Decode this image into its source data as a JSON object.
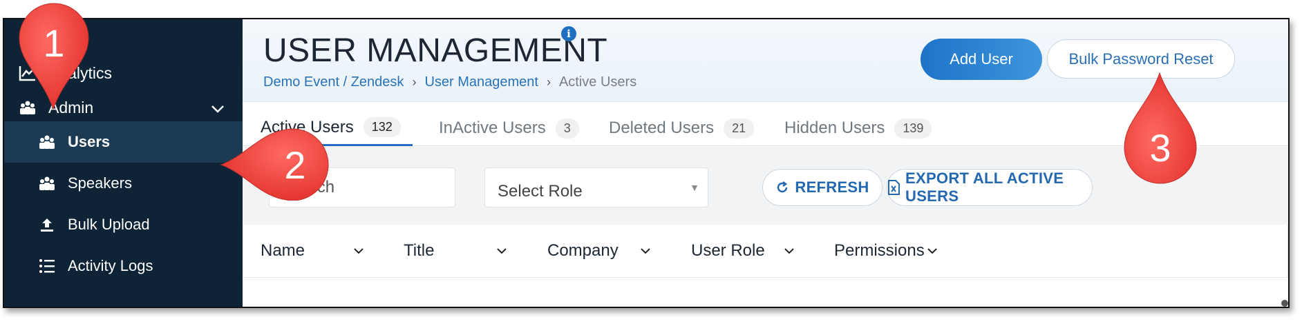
{
  "sidebar": {
    "items": [
      {
        "label": "Analytics",
        "icon": "line-chart-icon"
      },
      {
        "label": "Admin",
        "icon": "group-icon"
      },
      {
        "label": "Users",
        "icon": "group-icon"
      },
      {
        "label": "Speakers",
        "icon": "group-icon"
      },
      {
        "label": "Bulk Upload",
        "icon": "upload-icon"
      },
      {
        "label": "Activity Logs",
        "icon": "list-icon"
      }
    ]
  },
  "header": {
    "title": "USER MANAGEMENT",
    "info": "i",
    "breadcrumb": [
      "Demo Event / Zendesk",
      "User Management",
      "Active Users"
    ],
    "add_user": "Add User",
    "bulk_reset": "Bulk Password Reset"
  },
  "tabs": [
    {
      "label": "Active Users",
      "count": "132"
    },
    {
      "label": "InActive Users",
      "count": "3"
    },
    {
      "label": "Deleted Users",
      "count": "21"
    },
    {
      "label": "Hidden Users",
      "count": "139"
    }
  ],
  "toolbar": {
    "search_placeholder": "Search",
    "select_role": "Select Role",
    "refresh": "REFRESH",
    "export": "EXPORT ALL ACTIVE USERS"
  },
  "table": {
    "columns": [
      "Name",
      "Title",
      "Company",
      "User Role",
      "Permissions"
    ]
  },
  "callouts": [
    "1",
    "2",
    "3"
  ],
  "colors": {
    "sidebar_bg": "#0e2436",
    "accent": "#1f6fc0",
    "callout_red": "#f0443f"
  }
}
